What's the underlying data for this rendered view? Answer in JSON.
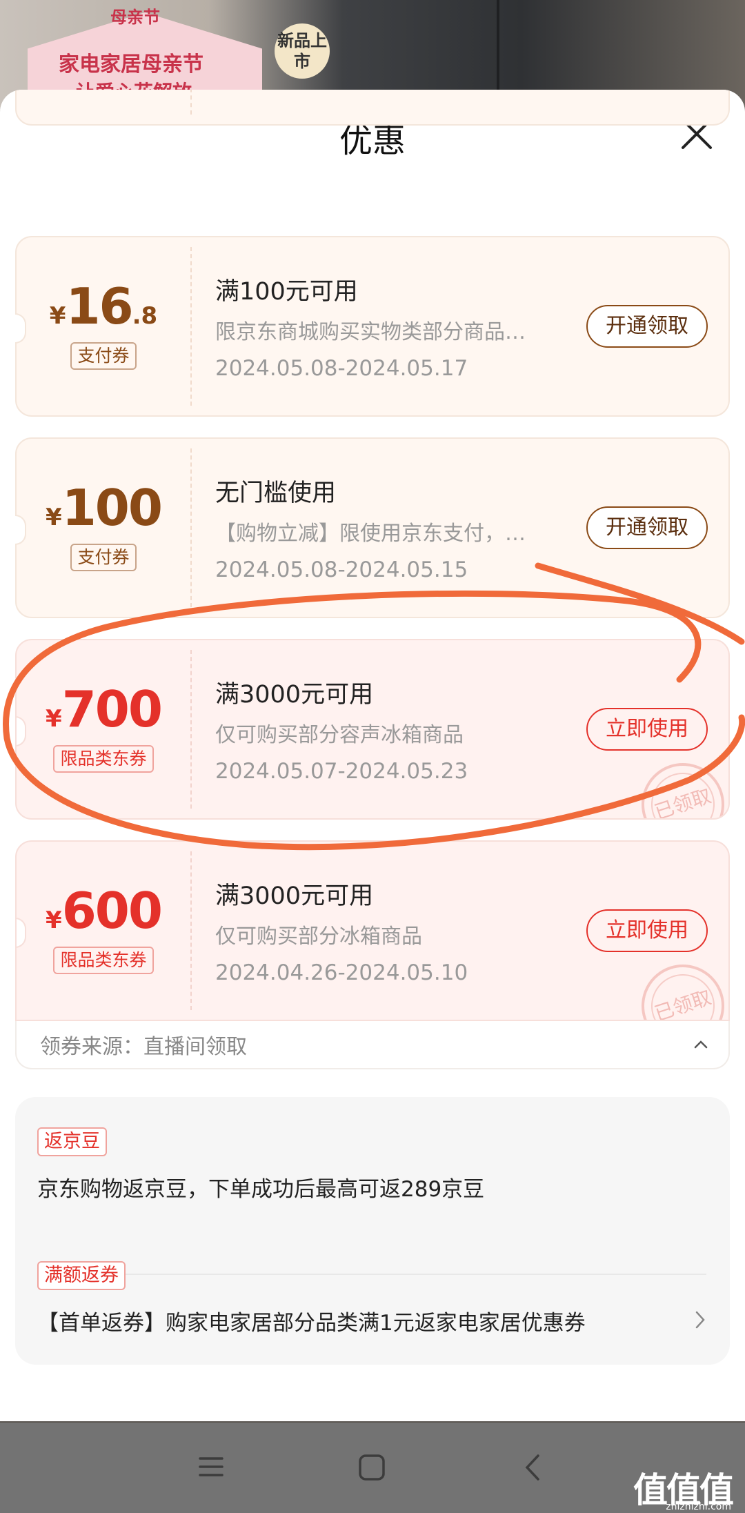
{
  "background": {
    "banner_tag": "母亲节",
    "banner_main": "家电家居母亲节",
    "banner_sub": "让爱心花解放",
    "new_badge": "新品上市"
  },
  "sheet": {
    "title": "优惠",
    "close_icon": "close-icon"
  },
  "coupons": [
    {
      "yen": "¥",
      "amount": "16",
      "decimal": ".8",
      "type": "支付券",
      "condition": "满100元可用",
      "desc": "限京东商城购买实物类部分商品…",
      "date": "2024.05.08-2024.05.17",
      "button": "开通领取",
      "stamp": ""
    },
    {
      "yen": "¥",
      "amount": "100",
      "decimal": "",
      "type": "支付券",
      "condition": "无门槛使用",
      "desc": "【购物立减】限使用京东支付，…",
      "date": "2024.05.08-2024.05.15",
      "button": "开通领取",
      "stamp": ""
    },
    {
      "yen": "¥",
      "amount": "700",
      "decimal": "",
      "type": "限品类东券",
      "condition": "满3000元可用",
      "desc": "仅可购买部分容声冰箱商品",
      "date": "2024.05.07-2024.05.23",
      "button": "立即使用",
      "stamp": "已领取"
    },
    {
      "yen": "¥",
      "amount": "600",
      "decimal": "",
      "type": "限品类东券",
      "condition": "满3000元可用",
      "desc": "仅可购买部分冰箱商品",
      "date": "2024.04.26-2024.05.10",
      "button": "立即使用",
      "stamp": "已领取"
    }
  ],
  "source": {
    "text": "领券来源：直播间领取",
    "icon": "chevron-up-icon"
  },
  "perks": [
    {
      "tag": "返京豆",
      "text": "京东购物返京豆，下单成功后最高可返289京豆"
    },
    {
      "tag": "满额返券",
      "text": "【首单返券】购家电家居部分品类满1元返家电家居优惠券"
    }
  ],
  "navbar": {
    "icons": [
      "menu-icon",
      "home-square-icon",
      "back-icon"
    ]
  },
  "watermark": {
    "logo": "值值值",
    "url": "zhizhizhi.com"
  },
  "colors": {
    "brown": "#8a4a16",
    "red": "#e4312a",
    "annotation": "#f06a3a"
  }
}
